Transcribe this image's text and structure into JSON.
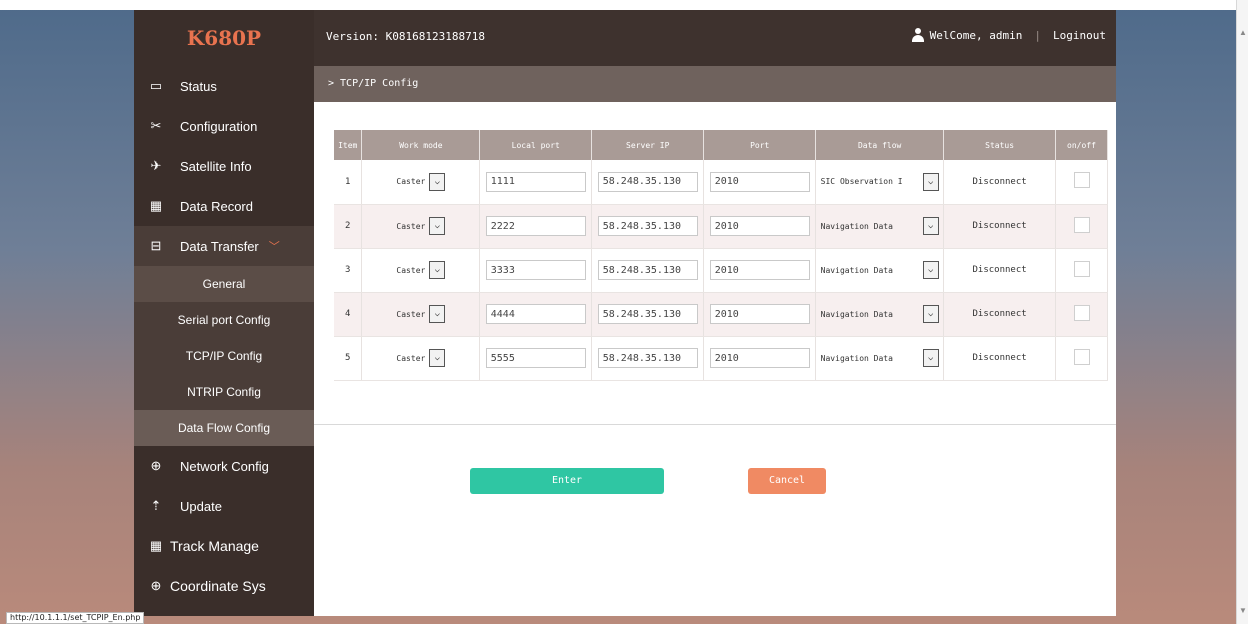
{
  "header": {
    "logo": "K680P",
    "version": "Version: K08168123188718",
    "welcome": "WelCome, admin",
    "logout": "Loginout"
  },
  "sidebar": {
    "items": [
      {
        "label": "Status",
        "icon": "monitor-icon"
      },
      {
        "label": "Configuration",
        "icon": "tools-icon"
      },
      {
        "label": "Satellite Info",
        "icon": "satellite-icon"
      },
      {
        "label": "Data Record",
        "icon": "calendar-icon"
      },
      {
        "label": "Data Transfer",
        "icon": "transfer-icon"
      }
    ],
    "sub_items": [
      "General",
      "Serial port Config",
      "TCP/IP Config",
      "NTRIP Config",
      "Data Flow Config"
    ],
    "bottom_items": [
      {
        "label": "Network Config",
        "icon": "globe-icon"
      },
      {
        "label": "Update",
        "icon": "upload-icon"
      },
      {
        "label": "Track Manage",
        "icon": "calendar-icon"
      },
      {
        "label": "Coordinate Sys",
        "icon": "globe-icon"
      }
    ]
  },
  "breadcrumb": "> TCP/IP Config",
  "table": {
    "headers": [
      "Item",
      "Work mode",
      "Local port",
      "Server IP",
      "Port",
      "Data flow",
      "Status",
      "on/off"
    ],
    "rows": [
      {
        "item": "1",
        "mode": "Caster",
        "local_port": "1111",
        "server_ip": "58.248.35.130",
        "port": "2010",
        "data_flow": "SIC Observation I",
        "status": "Disconnect"
      },
      {
        "item": "2",
        "mode": "Caster",
        "local_port": "2222",
        "server_ip": "58.248.35.130",
        "port": "2010",
        "data_flow": "Navigation Data",
        "status": "Disconnect"
      },
      {
        "item": "3",
        "mode": "Caster",
        "local_port": "3333",
        "server_ip": "58.248.35.130",
        "port": "2010",
        "data_flow": "Navigation Data",
        "status": "Disconnect"
      },
      {
        "item": "4",
        "mode": "Caster",
        "local_port": "4444",
        "server_ip": "58.248.35.130",
        "port": "2010",
        "data_flow": "Navigation Data",
        "status": "Disconnect"
      },
      {
        "item": "5",
        "mode": "Caster",
        "local_port": "5555",
        "server_ip": "58.248.35.130",
        "port": "2010",
        "data_flow": "Navigation Data",
        "status": "Disconnect"
      }
    ]
  },
  "buttons": {
    "enter": "Enter",
    "cancel": "Cancel"
  },
  "statusbar": "http://10.1.1.1/set_TCPIP_En.php",
  "colors": {
    "sidebar": "#3a2e2a",
    "accent": "#e8734f",
    "enter": "#2fc6a3",
    "cancel": "#f08a63",
    "table_header": "#a99b96"
  }
}
